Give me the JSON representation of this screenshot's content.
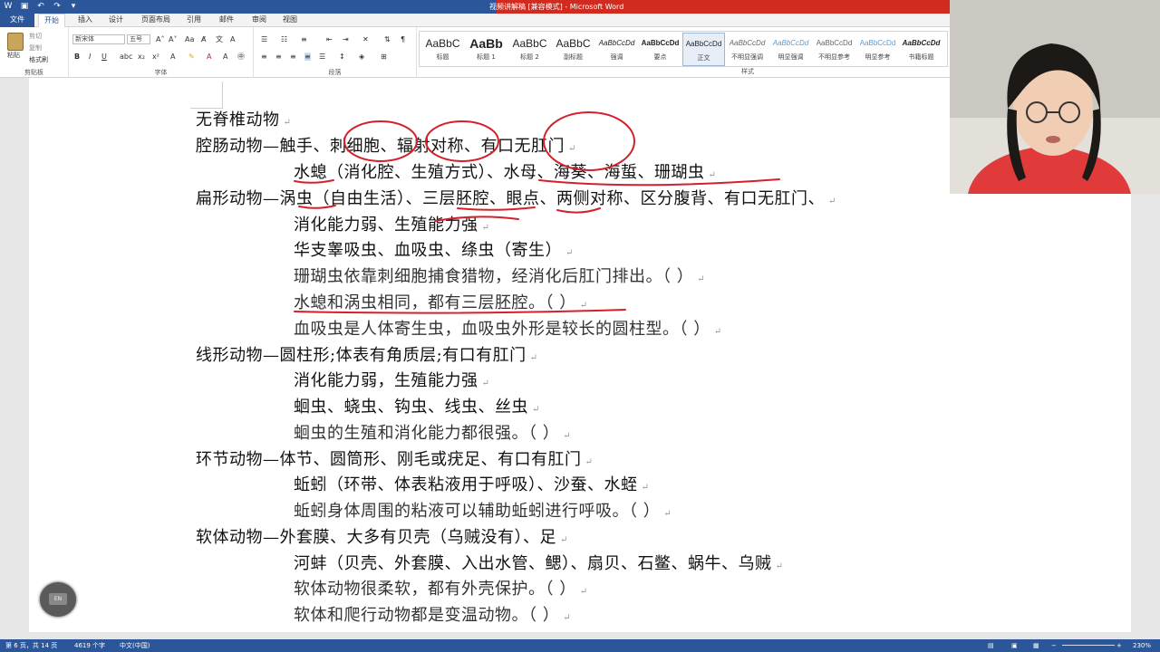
{
  "titlebar": {
    "window_title": "视频讲解稿 [兼容模式] - Microsoft Word",
    "quick_access": [
      "word-app-icon",
      "save-icon",
      "undo-icon",
      "redo-icon",
      "customize-icon"
    ]
  },
  "ribbon_tabs": [
    "文件",
    "开始",
    "插入",
    "设计",
    "页面布局",
    "引用",
    "邮件",
    "审阅",
    "视图"
  ],
  "ribbon": {
    "clipboard": {
      "paste": "粘贴",
      "cut": "剪切",
      "copy": "复制",
      "format_painter": "格式刷",
      "label": "剪贴板"
    },
    "font": {
      "name": "新宋体",
      "size": "五号",
      "label": "字体"
    },
    "paragraph": {
      "label": "段落"
    },
    "styles": {
      "label": "样式",
      "items": [
        {
          "sample": "AaBbC",
          "name": "标题"
        },
        {
          "sample": "AaBb",
          "name": "标题 1"
        },
        {
          "sample": "AaBbC",
          "name": "标题 2"
        },
        {
          "sample": "AaBbC",
          "name": "副标题"
        },
        {
          "sample": "AaBbCcDd",
          "name": "强调"
        },
        {
          "sample": "AaBbCcDd",
          "name": "要点"
        },
        {
          "sample": "AaBbCcDd",
          "name": "正文"
        },
        {
          "sample": "AaBbCcDd",
          "name": "不明显强调"
        },
        {
          "sample": "AaBbCcDd",
          "name": "明显强调"
        },
        {
          "sample": "AaBbCcDd",
          "name": "不明显参考"
        },
        {
          "sample": "AaBbCcDd",
          "name": "明显参考"
        },
        {
          "sample": "AaBbCcDd",
          "name": "书籍标题"
        }
      ],
      "selected": "正文"
    }
  },
  "document": {
    "lines": [
      "无脊椎动物",
      "腔肠动物—触手、刺细胞、辐射对称、有口无肛门",
      "水螅（消化腔、生殖方式）、水母、海葵、海蜇、珊瑚虫",
      "扁形动物—涡虫（自由生活）、三层胚腔、眼点、两侧对称、区分腹背、有口无肛门、",
      "消化能力弱、生殖能力强",
      "华支睾吸虫、血吸虫、绦虫（寄生）",
      "珊瑚虫依靠刺细胞捕食猎物，经消化后肛门排出。（    ）",
      "水螅和涡虫相同，都有三层胚腔。（    ）",
      "血吸虫是人体寄生虫，血吸虫外形是较长的圆柱型。（    ）",
      "线形动物—圆柱形;体表有角质层;有口有肛门",
      "消化能力弱，生殖能力强",
      "蛔虫、蛲虫、钩虫、线虫、丝虫",
      "蛔虫的生殖和消化能力都很强。（    ）",
      "环节动物—体节、圆筒形、刚毛或疣足、有口有肛门",
      "蚯蚓（环带、体表粘液用于呼吸）、沙蚕、水蛭",
      "蚯蚓身体周围的粘液可以辅助蚯蚓进行呼吸。（    ）",
      "软体动物—外套膜、大多有贝壳（乌贼没有）、足",
      "河蚌（贝壳、外套膜、入出水管、鳃）、扇贝、石鳖、蜗牛、乌贼",
      "软体动物很柔软，都有外壳保护。（    ）",
      "软体和爬行动物都是变温动物。（    ）"
    ],
    "paragraph_mark": "↵"
  },
  "ime": {
    "label": "EN"
  },
  "statusbar": {
    "page": "第 6 页，共 14 页",
    "words": "4619 个字",
    "language": "中文(中国)",
    "zoom": "230%"
  },
  "colors": {
    "title_bar": "#2b579a",
    "ink": "#d3202a"
  }
}
